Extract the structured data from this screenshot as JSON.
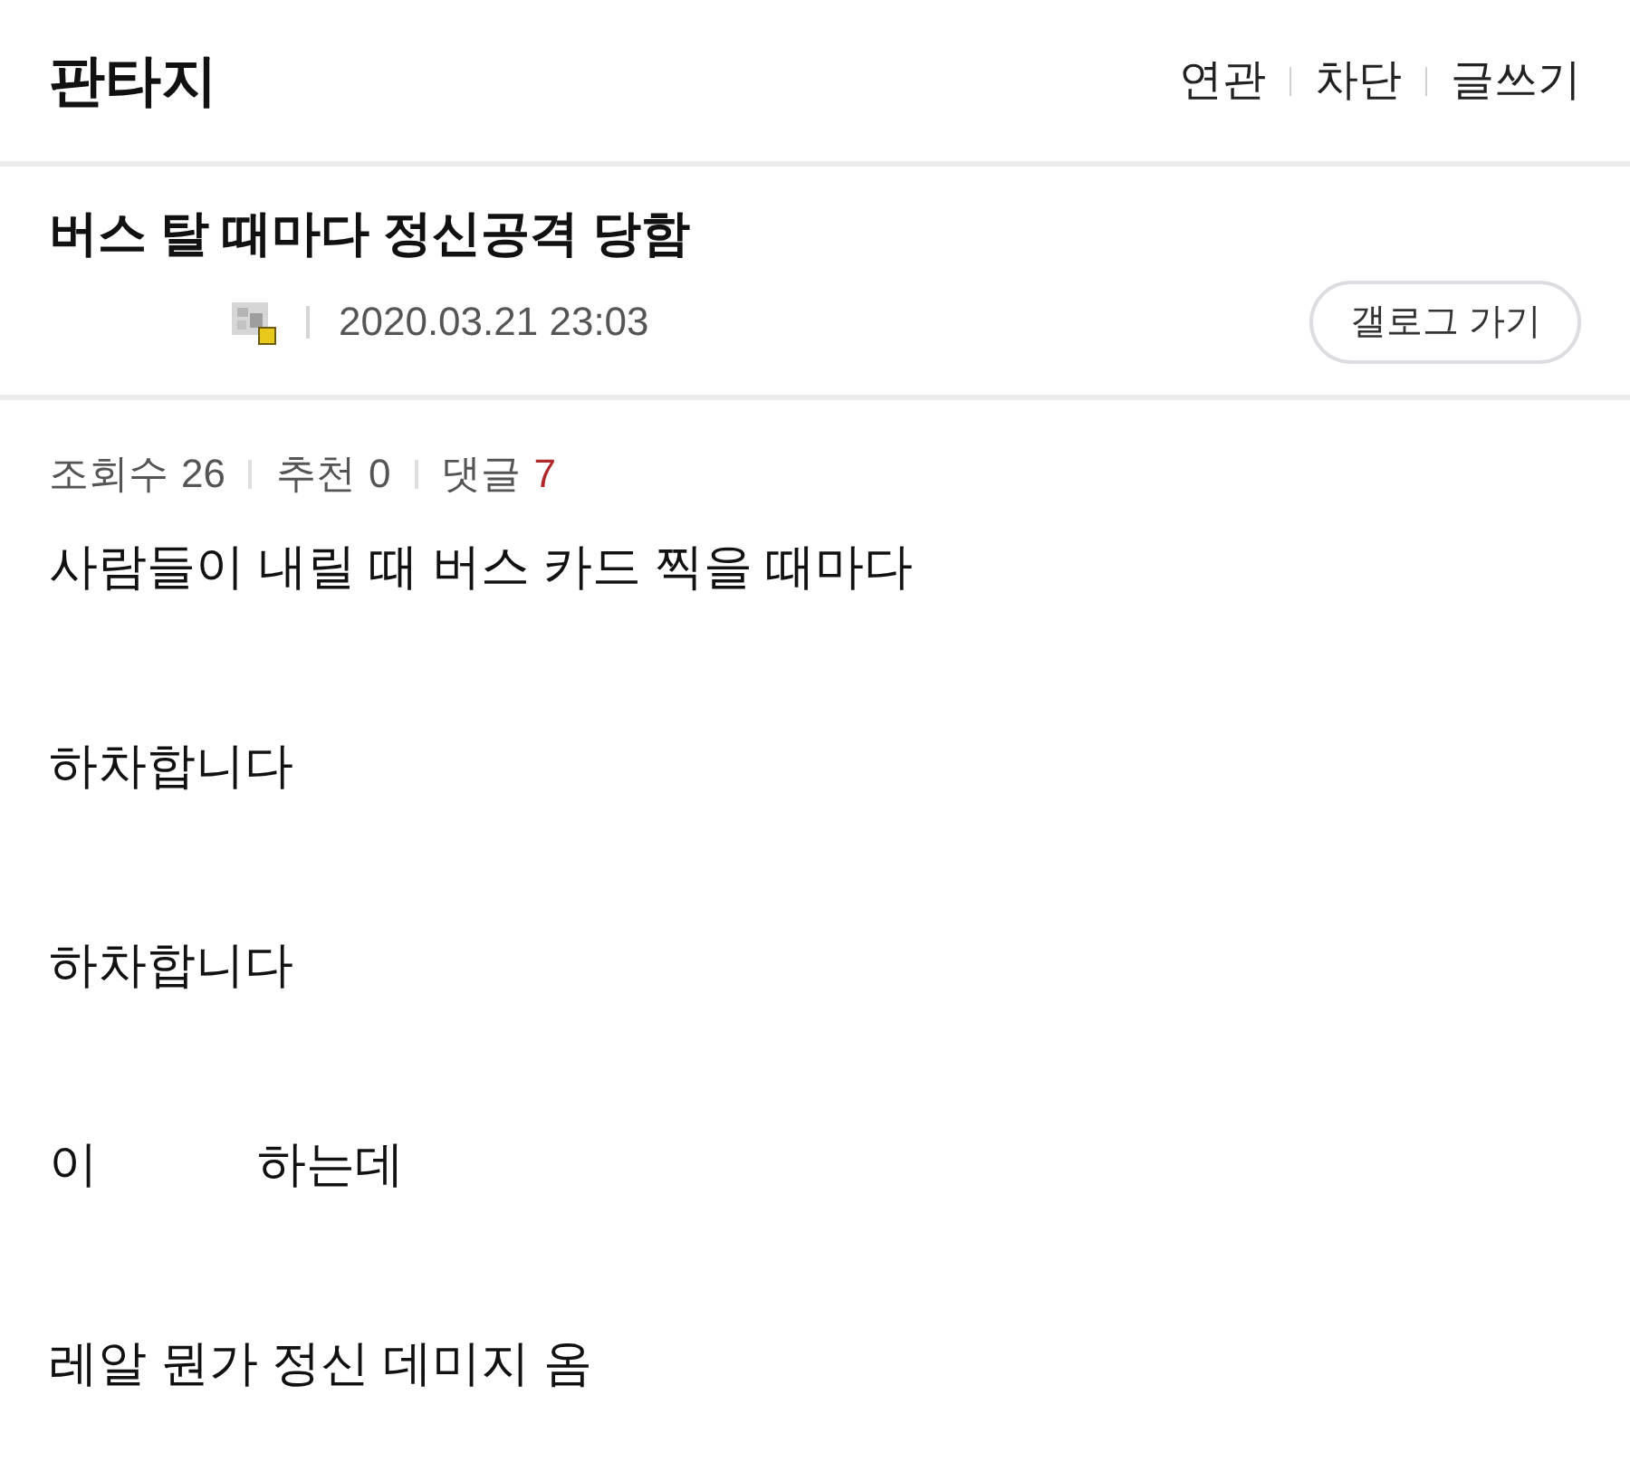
{
  "header": {
    "title": "판타지",
    "links": [
      "연관",
      "차단",
      "글쓰기"
    ]
  },
  "post": {
    "title": "버스 탈 때마다 정신공격 당함",
    "date": "2020.03.21 23:03",
    "gallog_button": "갤로그 가기"
  },
  "stats": [
    {
      "label": "조회수",
      "value": "26",
      "kind": "plain"
    },
    {
      "label": "추천",
      "value": "0",
      "kind": "plain"
    },
    {
      "label": "댓글",
      "value": "7",
      "kind": "accent"
    }
  ],
  "body": [
    {
      "segments": [
        "사람들이 내릴 때 버스 카드 찍을 때마다"
      ]
    },
    {
      "segments": [
        "하차합니다"
      ]
    },
    {
      "segments": [
        "하차합니다"
      ]
    },
    {
      "segments": [
        "이",
        "하는데"
      ]
    },
    {
      "segments": [
        "레알 뭔가 정신 데미지 옴"
      ]
    }
  ]
}
